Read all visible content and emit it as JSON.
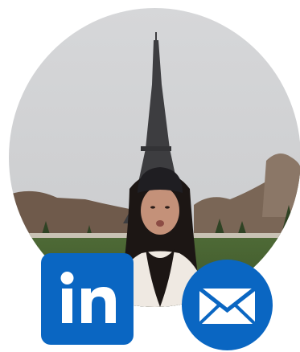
{
  "profile": {
    "avatar_icon": "profile-photo-eiffel-tower"
  },
  "links": {
    "linkedin": {
      "icon": "linkedin-icon",
      "glyph": "in",
      "color": "#0a66c2"
    },
    "email": {
      "icon": "mail-icon",
      "color": "#0a66c2"
    }
  }
}
